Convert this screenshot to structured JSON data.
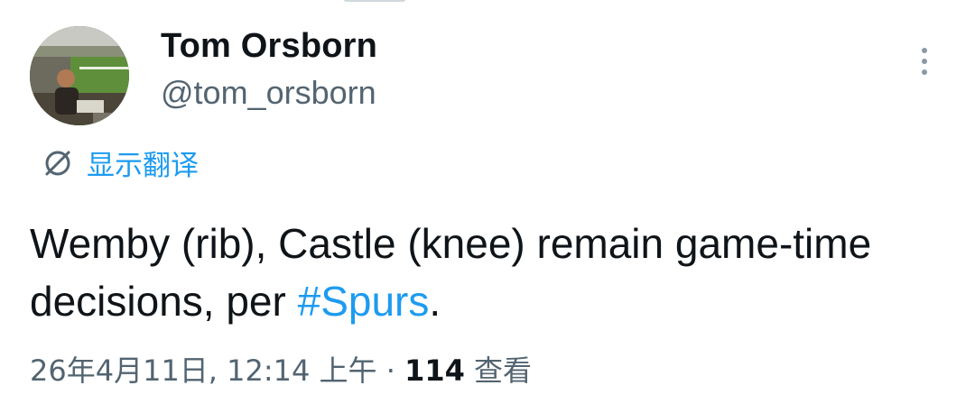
{
  "author": {
    "display_name": "Tom Orsborn",
    "handle": "@tom_orsborn"
  },
  "icons": {
    "more": "more-vertical-icon",
    "translate": "globe-icon",
    "avatar": "profile-photo"
  },
  "translate": {
    "label": "显示翻译"
  },
  "tweet": {
    "text_part1": "Wemby (rib), Castle (knee) remain game-time decisions, per ",
    "hashtag": "#Spurs",
    "text_part2": "."
  },
  "meta": {
    "datetime": "26年4月11日, 12:14 上午",
    "separator": "·",
    "views_count": "114",
    "views_label": "查看"
  },
  "colors": {
    "link": "#1d9bf0",
    "secondary_text": "#536471",
    "primary_text": "#0f1419"
  }
}
